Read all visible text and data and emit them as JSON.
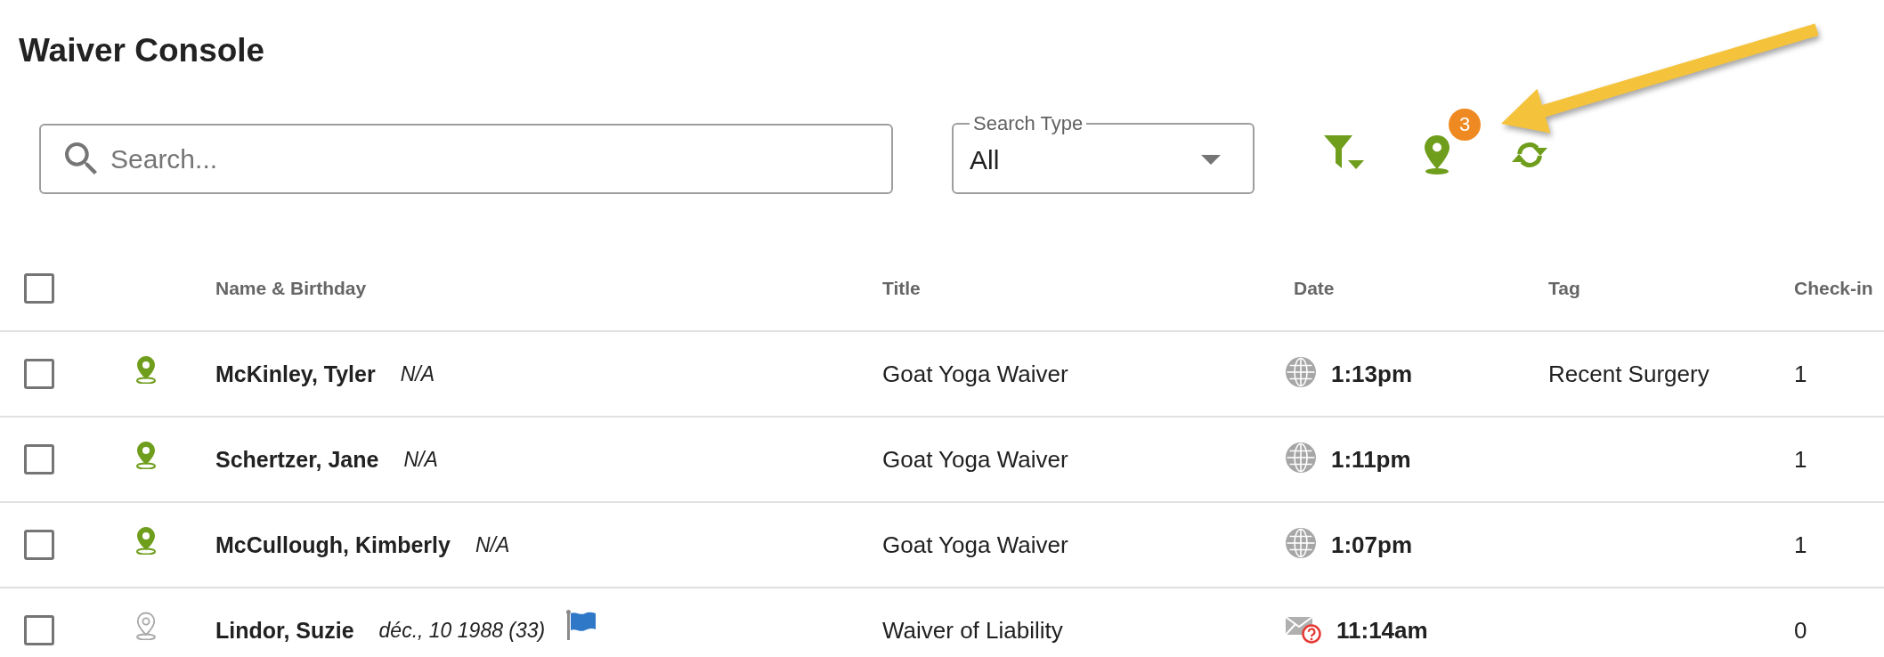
{
  "page": {
    "title": "Waiver Console"
  },
  "toolbar": {
    "search": {
      "placeholder": "Search..."
    },
    "search_type": {
      "label": "Search Type",
      "value": "All"
    },
    "location_filter": {
      "badge": "3"
    }
  },
  "table": {
    "all_checked": false,
    "columns": [
      "Name & Birthday",
      "Title",
      "Date",
      "Tag",
      "Check-in"
    ],
    "rows": [
      {
        "checked": false,
        "location_on": true,
        "name": "McKinley, Tyler",
        "birthday": "N/A",
        "flagged": false,
        "title": "Goat Yoga Waiver",
        "via_email": false,
        "time": "1:13pm",
        "tag": "Recent Surgery",
        "checkins": "1"
      },
      {
        "checked": false,
        "location_on": true,
        "name": "Schertzer, Jane",
        "birthday": "N/A",
        "flagged": false,
        "title": "Goat Yoga Waiver",
        "via_email": false,
        "time": "1:11pm",
        "checkins": "1"
      },
      {
        "checked": false,
        "location_on": true,
        "name": "McCullough, Kimberly",
        "birthday": "N/A",
        "flagged": false,
        "title": "Goat Yoga Waiver",
        "via_email": false,
        "time": "1:07pm",
        "checkins": "1"
      },
      {
        "checked": false,
        "location_on": false,
        "name": "Lindor, Suzie",
        "birthday": "déc., 10 1988 (33)",
        "flagged": true,
        "title": "Waiver of Liability",
        "via_email": true,
        "time": "11:14am",
        "checkins": "0"
      }
    ]
  }
}
